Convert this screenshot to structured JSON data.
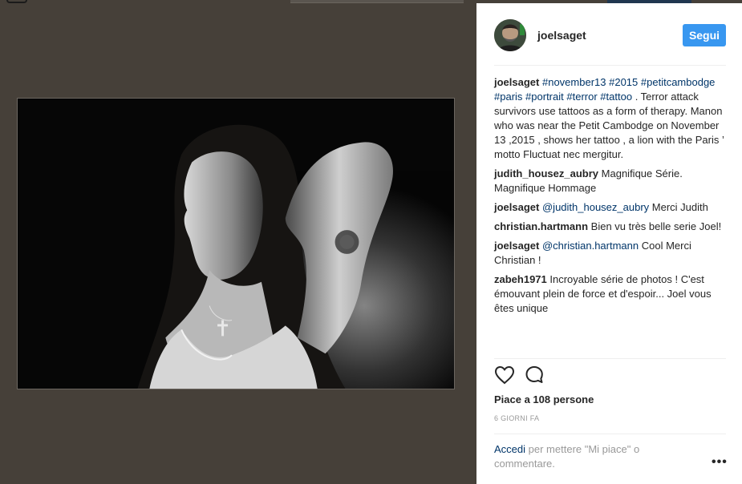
{
  "post": {
    "username": "joelsaget",
    "follow_label": "Segui",
    "caption": {
      "user": "joelsaget",
      "tags_line1": [
        "#november13",
        "#2015"
      ],
      "tags_line2": [
        "#petitcambodge",
        "#paris",
        "#portrait",
        "#terror"
      ],
      "tag_line3": "#tattoo",
      "text": ". Terror attack survivors use tattoos as a form of therapy. Manon who was near the Petit Cambodge on November 13 ,2015 , shows her tattoo , a lion with the Paris ’ motto Fluctuat nec mergitur."
    },
    "comments": [
      {
        "user": "judith_housez_aubry",
        "mention": "",
        "text": "Magnifique Série. Magnifique Hommage"
      },
      {
        "user": "joelsaget",
        "mention": "@judith_housez_aubry",
        "text": "Merci Judith"
      },
      {
        "user": "christian.hartmann",
        "mention": "",
        "text": "Bien vu très belle serie Joel!"
      },
      {
        "user": "joelsaget",
        "mention": "@christian.hartmann",
        "text": "Cool Merci Christian !"
      },
      {
        "user": "zabeh1971",
        "mention": "",
        "text": "Incroyable série de photos ! C'est émouvant plein de force et d'espoir... Joel vous êtes unique"
      }
    ],
    "likes": "Piace a 108 persone",
    "time_ago": "6 GIORNI FA",
    "login_link": "Accedi",
    "login_text": "per mettere \"Mi piace\" o commentare.",
    "more_label": "•••"
  },
  "icons": {
    "like": "heart-icon",
    "comment": "comment-bubble-icon",
    "more": "more-options-icon"
  },
  "colors": {
    "follow_button": "#3897f0",
    "link": "#003569",
    "background_overlay": "#464039"
  }
}
